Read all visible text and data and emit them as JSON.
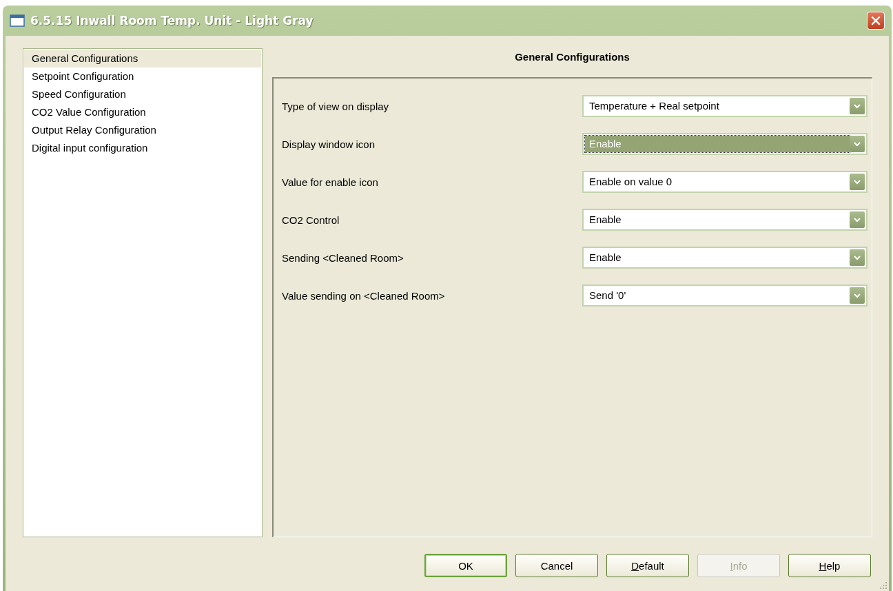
{
  "window": {
    "title": "6.5.15 Inwall Room Temp. Unit - Light Gray"
  },
  "sidebar": {
    "items": [
      {
        "label": "General Configurations",
        "selected": true
      },
      {
        "label": "Setpoint Configuration",
        "selected": false
      },
      {
        "label": "Speed Configuration",
        "selected": false
      },
      {
        "label": "CO2 Value Configuration",
        "selected": false
      },
      {
        "label": "Output Relay Configuration",
        "selected": false
      },
      {
        "label": "Digital input configuration",
        "selected": false
      }
    ]
  },
  "panel": {
    "heading": "General Configurations",
    "parameters": [
      {
        "label": "Type of view on display",
        "value": "Temperature + Real setpoint",
        "focused": false
      },
      {
        "label": "Display window icon",
        "value": "Enable",
        "focused": true
      },
      {
        "label": "Value for enable icon",
        "value": "Enable on value 0",
        "focused": false
      },
      {
        "label": "CO2 Control",
        "value": "Enable",
        "focused": false
      },
      {
        "label": "Sending <Cleaned Room>",
        "value": "Enable",
        "focused": false
      },
      {
        "label": "Value sending on <Cleaned Room>",
        "value": "Send '0'",
        "focused": false
      }
    ]
  },
  "buttons": [
    {
      "label": "OK",
      "default": true,
      "disabled": false,
      "underline_first": false
    },
    {
      "label": "Cancel",
      "default": false,
      "disabled": false,
      "underline_first": false
    },
    {
      "label": "Default",
      "default": false,
      "disabled": false,
      "underline_first": true
    },
    {
      "label": "Info",
      "default": false,
      "disabled": true,
      "underline_first": true
    },
    {
      "label": "Help",
      "default": false,
      "disabled": false,
      "underline_first": true
    }
  ]
}
